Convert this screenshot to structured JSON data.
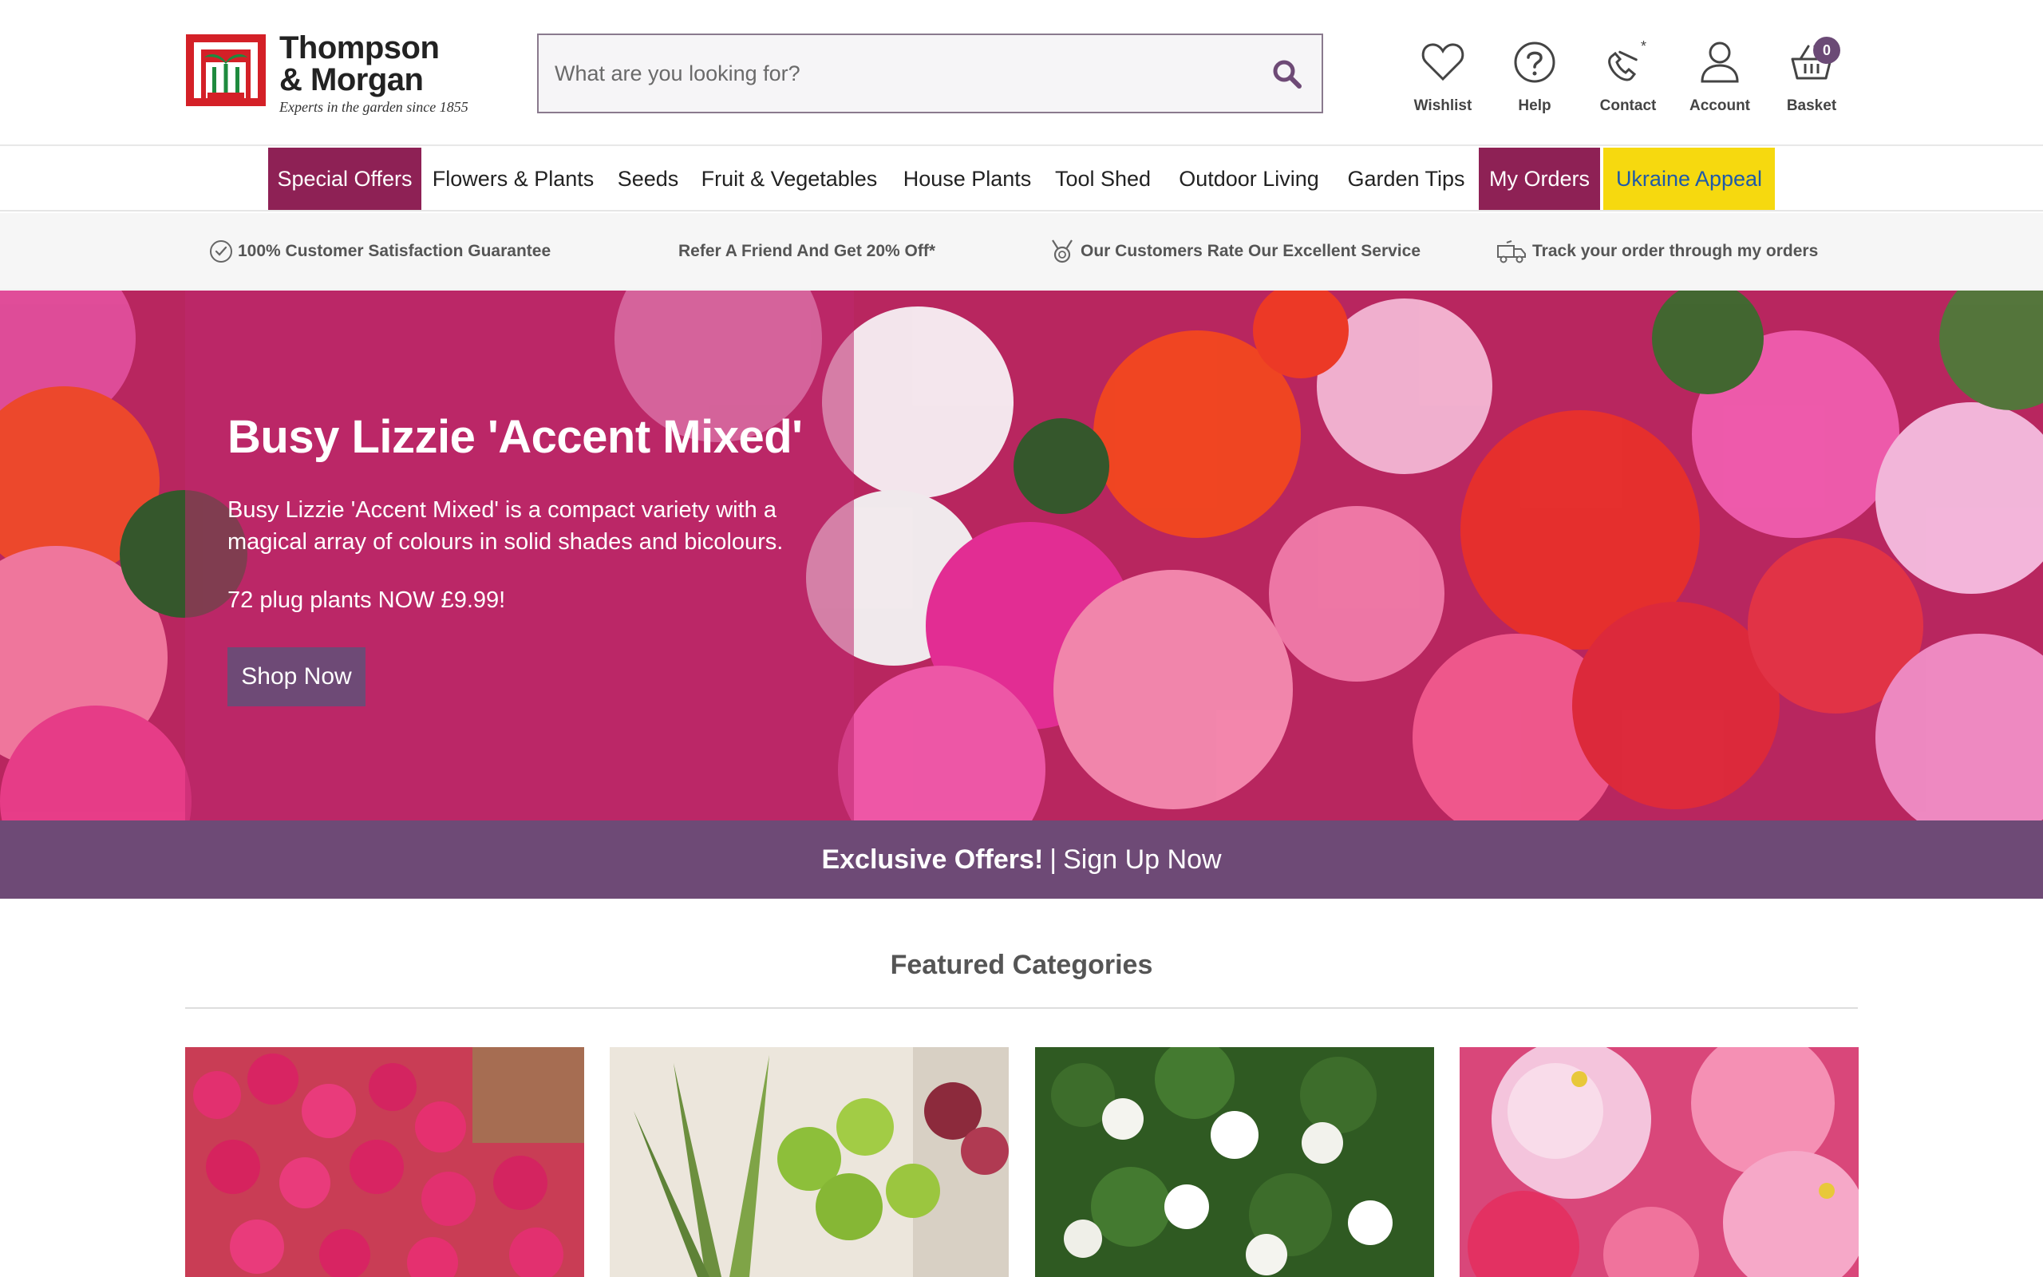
{
  "brand": {
    "name_line1": "Thompson",
    "name_line2": "& Morgan",
    "tagline": "Experts in the garden since 1855",
    "logo_red": "#d42027",
    "logo_green": "#1e8a3e"
  },
  "search": {
    "placeholder": "What are you looking for?",
    "icon": "search-icon"
  },
  "utility": [
    {
      "label": "Wishlist",
      "icon": "heart-icon"
    },
    {
      "label": "Help",
      "icon": "question-icon"
    },
    {
      "label": "Contact",
      "icon": "phone-icon"
    },
    {
      "label": "Account",
      "icon": "user-icon"
    },
    {
      "label": "Basket",
      "icon": "basket-icon",
      "count": "0"
    }
  ],
  "nav": [
    {
      "label": "Special Offers"
    },
    {
      "label": "Flowers & Plants"
    },
    {
      "label": "Seeds"
    },
    {
      "label": "Fruit & Vegetables"
    },
    {
      "label": "House Plants"
    },
    {
      "label": "Tool Shed"
    },
    {
      "label": "Outdoor Living"
    },
    {
      "label": "Garden Tips"
    },
    {
      "label": "My Orders"
    },
    {
      "label": "Ukraine Appeal"
    }
  ],
  "usp": [
    {
      "label": "100% Customer Satisfaction Guarantee",
      "icon": "check-circle-icon"
    },
    {
      "label": "Refer A Friend And Get 20% Off*"
    },
    {
      "label": "Our Customers Rate Our Excellent Service",
      "icon": "award-icon"
    },
    {
      "label": "Track your order through my orders",
      "icon": "delivery-truck-icon"
    }
  ],
  "hero": {
    "title": "Busy Lizzie 'Accent Mixed'",
    "description": "Busy Lizzie 'Accent Mixed' is a compact variety with a magical array of colours in solid shades and bicolours.",
    "price": "72 plug plants NOW £9.99!",
    "button": "Shop Now"
  },
  "signup": {
    "bold": "Exclusive Offers!",
    "separator": "|",
    "text": "Sign Up Now"
  },
  "featured": {
    "title": "Featured Categories"
  },
  "colors": {
    "primary": "#8e2155",
    "purple": "#6e4a76",
    "yellow": "#f6d90f",
    "ukraine_text": "#1f5aa8"
  }
}
